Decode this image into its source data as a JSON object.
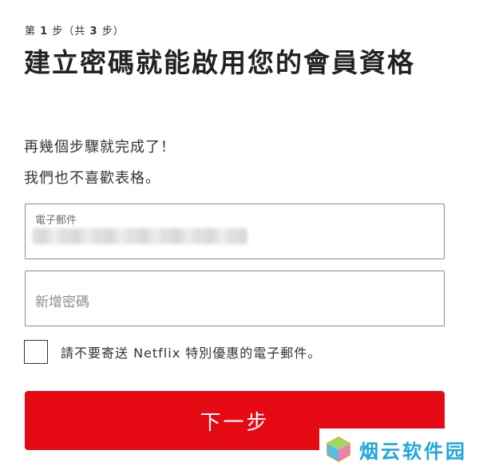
{
  "step": {
    "prefix": "第",
    "current": "1",
    "middle": "步（共",
    "total": "3",
    "suffix": "步）"
  },
  "title": "建立密碼就能啟用您的會員資格",
  "subtitle_1": "再幾個步驟就完成了！",
  "subtitle_2": "我們也不喜歡表格。",
  "email_field": {
    "label": "電子郵件",
    "value_redacted": true
  },
  "password_field": {
    "placeholder": "新增密碼",
    "value": ""
  },
  "opt_out_checkbox": {
    "label": "請不要寄送 Netflix 特別優惠的電子郵件。",
    "checked": false
  },
  "next_button": {
    "label": "下一步"
  },
  "watermark": {
    "text": "烟云软件园"
  },
  "colors": {
    "accent": "#e50914",
    "watermark": "#1fa7d9"
  }
}
